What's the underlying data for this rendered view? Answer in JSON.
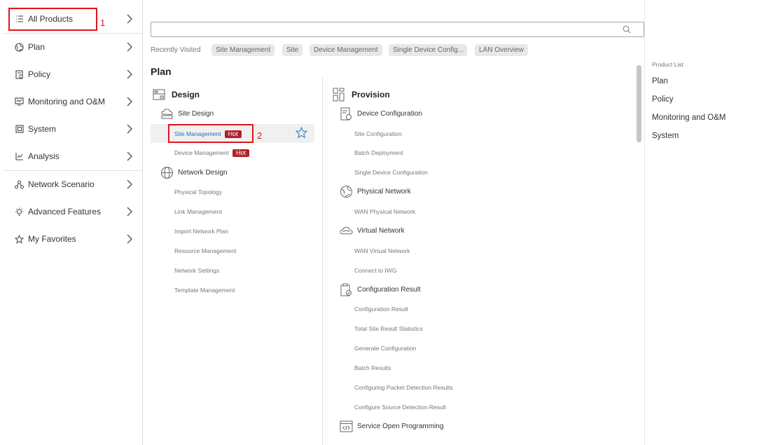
{
  "sidebar": {
    "items": [
      {
        "label": "All Products",
        "icon": "list-icon"
      },
      {
        "label": "Plan",
        "icon": "globe-icon"
      },
      {
        "label": "Policy",
        "icon": "policy-icon"
      },
      {
        "label": "Monitoring and O&M",
        "icon": "monitor-icon"
      },
      {
        "label": "System",
        "icon": "system-icon"
      },
      {
        "label": "Analysis",
        "icon": "chart-icon"
      },
      {
        "label": "Network Scenario",
        "icon": "network-icon"
      },
      {
        "label": "Advanced Features",
        "icon": "bulb-icon"
      },
      {
        "label": "My Favorites",
        "icon": "star-icon"
      }
    ]
  },
  "annotations": {
    "one": "1",
    "two": "2",
    "color": "#e0141e"
  },
  "search": {
    "placeholder": "",
    "value": ""
  },
  "recent": {
    "label": "Recently Visited",
    "chips": [
      "Site Management",
      "Site",
      "Device Management",
      "Single Device Config...",
      "LAN Overview"
    ]
  },
  "main": {
    "section_title": "Plan",
    "design": {
      "title": "Design",
      "site_design": {
        "title": "Site Design",
        "items": [
          {
            "label": "Site Management",
            "badge": "Hot"
          },
          {
            "label": "Device Management",
            "badge": "Hot"
          }
        ]
      },
      "network_design": {
        "title": "Network Design",
        "items": [
          "Physical Topology",
          "Link Management",
          "Import Network Plan",
          "Resource Management",
          "Network Settings",
          "Template Management"
        ]
      }
    },
    "provision": {
      "title": "Provision",
      "device_configuration": {
        "title": "Device Configuration",
        "items": [
          "Site Configuration",
          "Batch Deployment",
          "Single Device Configuration"
        ]
      },
      "physical_network": {
        "title": "Physical Network",
        "items": [
          "WAN Physical Network"
        ]
      },
      "virtual_network": {
        "title": "Virtual Network",
        "items": [
          "WAN Virtual Network",
          "Connect to IWG"
        ]
      },
      "configuration_result": {
        "title": "Configuration Result",
        "items": [
          "Configuration Result",
          "Total Site Result Statistics",
          "Generate Configuration",
          "Batch Results",
          "Configuring Packet Detection Results",
          "Configure Source Detection Result"
        ]
      },
      "service_open_programming": {
        "title": "Service Open Programming"
      }
    }
  },
  "product_list": {
    "label": "Product List",
    "items": [
      "Plan",
      "Policy",
      "Monitoring and O&M",
      "System"
    ]
  },
  "colors": {
    "accent": "#2a6dbd",
    "hot": "#b0222b",
    "annotation": "#e0141e"
  }
}
